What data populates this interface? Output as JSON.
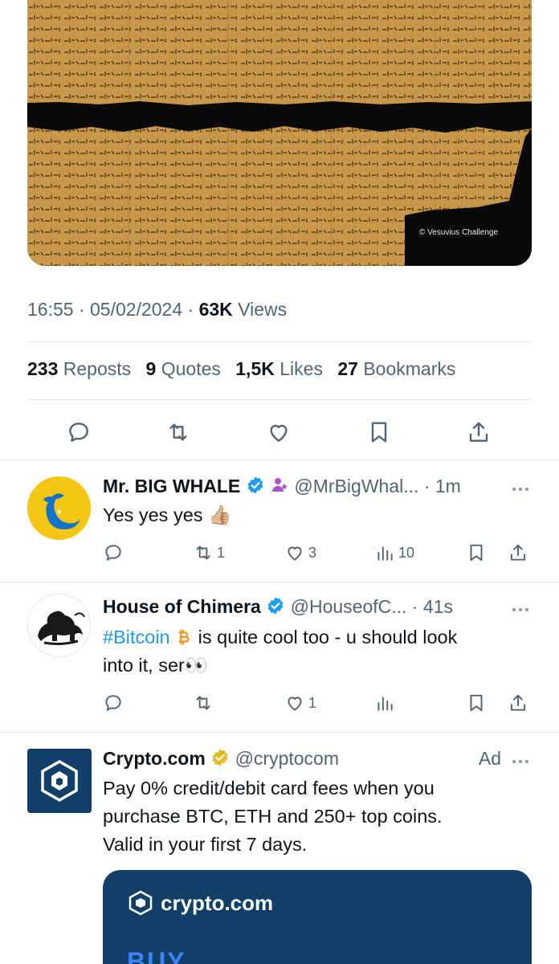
{
  "media": {
    "credit": "© Vesuvius Challenge",
    "colors": {
      "papyrus": "#c9974a",
      "ink": "#0a0a0a"
    }
  },
  "tweet_meta": {
    "time": "16:55",
    "date": "05/02/2024",
    "views_count": "63K",
    "views_label": "Views"
  },
  "stats": [
    {
      "num": "233",
      "label": "Reposts"
    },
    {
      "num": "9",
      "label": "Quotes"
    },
    {
      "num": "1,5K",
      "label": "Likes"
    },
    {
      "num": "27",
      "label": "Bookmarks"
    }
  ],
  "action_bar": [
    "reply-icon",
    "repost-icon",
    "like-icon",
    "bookmark-icon",
    "share-icon"
  ],
  "replies": [
    {
      "name": "Mr. BIG WHALE",
      "handle": "@MrBigWhal...",
      "time": "1m",
      "text": "Yes yes yes 👍🏼",
      "counts": {
        "reply": "",
        "repost": "1",
        "like": "3",
        "views": "10"
      }
    },
    {
      "name": "House of Chimera",
      "handle": "@HouseofC...",
      "time": "41s",
      "hashtag": "#Bitcoin",
      "text_line1": " is quite cool too - u should look",
      "text_line2": "into it, ser👀",
      "counts": {
        "reply": "",
        "repost": "",
        "like": "1",
        "views": ""
      }
    }
  ],
  "ad": {
    "name": "Crypto.com",
    "handle": "@cryptocom",
    "label": "Ad",
    "text_line1": "Pay 0% credit/debit card fees when you",
    "text_line2": "purchase BTC, ETH and 250+ top coins.",
    "text_line3": "Valid in your first 7 days.",
    "card_brand": "crypto.com",
    "card_headline": "BUY"
  },
  "colors": {
    "blue": "#1d9bf0",
    "gray": "#536471",
    "gold_badge": "#e8b923",
    "crypto_navy": "#103f68"
  }
}
